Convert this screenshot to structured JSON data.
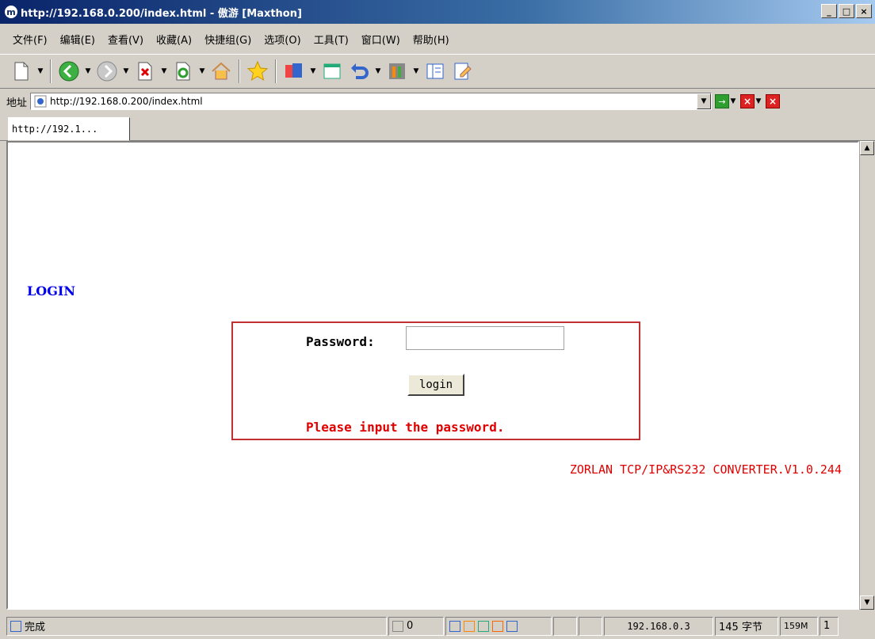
{
  "window": {
    "title": "http://192.168.0.200/index.html - 傲游 [Maxthon]",
    "logo": "m",
    "min": "_",
    "max": "□",
    "close": "×"
  },
  "menu": {
    "items": [
      "文件(F)",
      "编辑(E)",
      "查看(V)",
      "收藏(A)",
      "快捷组(G)",
      "选项(O)",
      "工具(T)",
      "窗口(W)",
      "帮助(H)"
    ]
  },
  "address": {
    "label": "地址",
    "url": "http://192.168.0.200/index.html",
    "go": "→",
    "close": "×"
  },
  "tab": {
    "label": "http://192.1..."
  },
  "page": {
    "heading": "LOGIN",
    "password_label": "Password:",
    "password_value": "",
    "login_button": "login",
    "message": "Please input the password.",
    "version": "ZORLAN TCP/IP&RS232 CONVERTER.V1.0.244"
  },
  "status": {
    "text": "完成",
    "count": "0",
    "ip": "192.168.0.3",
    "bytes": "145 字节",
    "memory": "159M",
    "page": "1"
  },
  "colors": {
    "link": "#0000ee",
    "error": "#e00000",
    "box_border": "#c03030"
  }
}
